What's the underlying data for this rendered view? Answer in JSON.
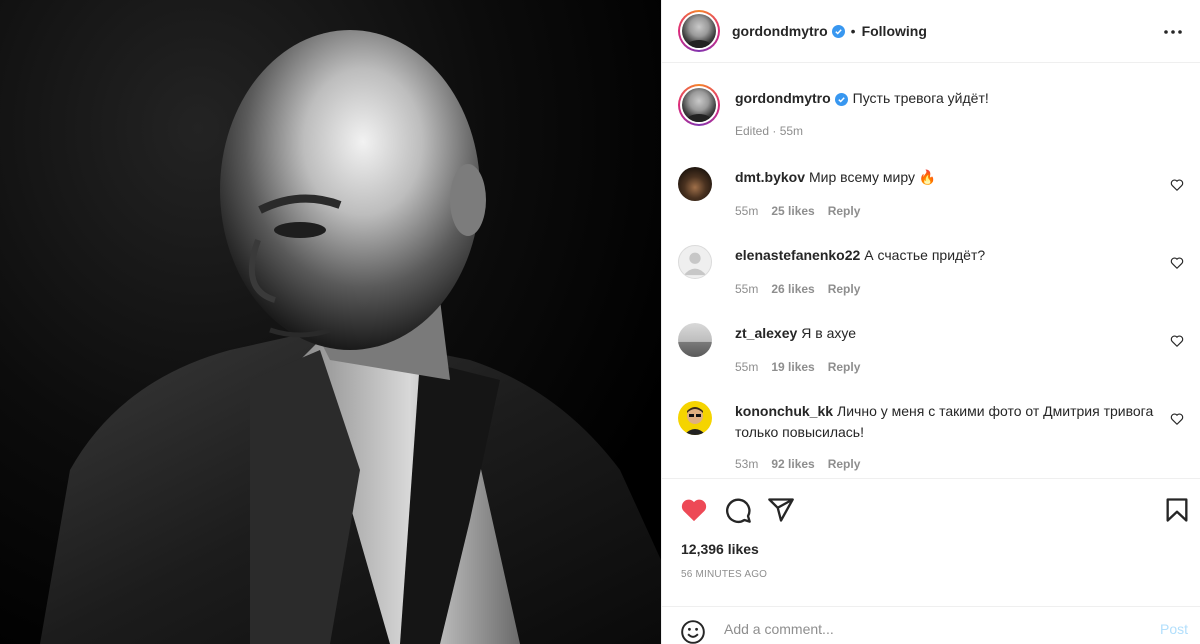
{
  "post": {
    "username": "gordondmytro",
    "follow_status": "Following",
    "caption": "Пусть тревога уйдёт!",
    "edited_label": "Edited · 55m",
    "likes": "12,396 likes",
    "time_ago": "56 MINUTES AGO"
  },
  "comments": [
    {
      "username": "dmt.bykov",
      "text": "Мир всему миру 🔥",
      "time": "55m",
      "likes": "25 likes",
      "reply": "Reply"
    },
    {
      "username": "elenastefanenko22",
      "text": "А счастье придёт?",
      "time": "55m",
      "likes": "26 likes",
      "reply": "Reply"
    },
    {
      "username": "zt_alexey",
      "text": "Я в ахуе",
      "time": "55m",
      "likes": "19 likes",
      "reply": "Reply"
    },
    {
      "username": "kononchuk_kk",
      "text": "Лично у меня с такими фото от Дмитрия тривога только повысилась!",
      "time": "53m",
      "likes": "92 likes",
      "reply": "Reply"
    }
  ],
  "composer": {
    "placeholder": "Add a comment...",
    "post_label": "Post"
  },
  "colors": {
    "like_red": "#ed4956",
    "verified_blue": "#3897f0",
    "post_disabled": "#b2dffc"
  },
  "icons": [
    "verified-icon",
    "more-options-icon",
    "heart-small-icon",
    "heart-filled-icon",
    "comment-icon",
    "share-icon",
    "bookmark-icon",
    "emoji-icon"
  ]
}
